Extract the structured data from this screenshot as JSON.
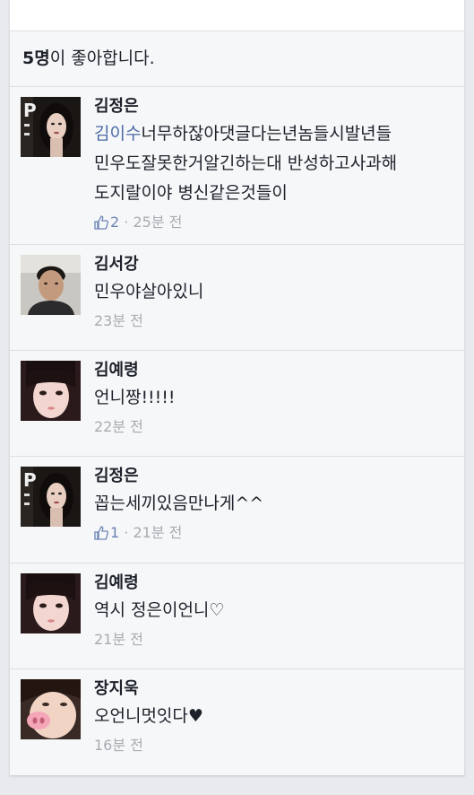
{
  "likes": {
    "count": "5명",
    "suffix": "이 좋아합니다."
  },
  "comments": [
    {
      "author": "김정은",
      "mention": "김이수",
      "lines": [
        "너무하잖아댓글다는년놈들시발년들",
        "민우도잘못한거알긴하는대 반성하고사과해",
        "도지랄이야 병신같은것들이"
      ],
      "likes": "2",
      "time": "25분 전",
      "avatar": "woman-dark-hair-icon"
    },
    {
      "author": "김서강",
      "lines": [
        "민우야살아있니"
      ],
      "time": "23분 전",
      "avatar": "young-man-icon"
    },
    {
      "author": "김예령",
      "lines": [
        "언니짱!!!!!"
      ],
      "time": "22분 전",
      "avatar": "woman-selfie-icon"
    },
    {
      "author": "김정은",
      "lines": [
        "꼽는세끼있음만나게^^"
      ],
      "likes": "1",
      "time": "21분 전",
      "avatar": "woman-dark-hair-icon"
    },
    {
      "author": "김예령",
      "lines": [
        "역시 정은이언니♡"
      ],
      "time": "21분 전",
      "avatar": "woman-selfie-icon"
    },
    {
      "author": "장지욱",
      "lines": [
        "오언니멋잇다♥"
      ],
      "time": "16분 전",
      "avatar": "pig-nose-selfie-icon"
    }
  ],
  "colors": {
    "mention": "#4b6aa6",
    "meta": "#a8abb1",
    "like_count": "#6d84b4"
  },
  "like_separator": " · "
}
